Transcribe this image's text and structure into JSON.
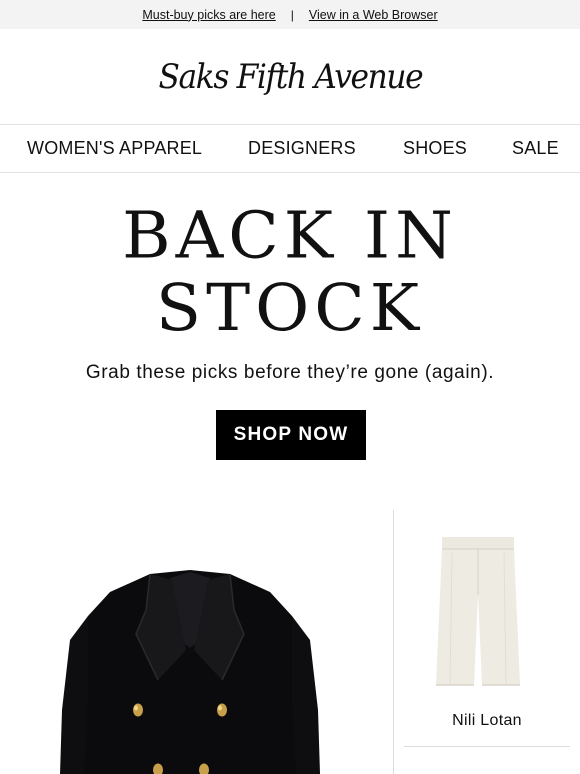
{
  "preheader": {
    "link1": "Must-buy picks are here",
    "separator": "|",
    "link2": "View in a Web Browser"
  },
  "logo": {
    "text": "Saks Fifth Avenue"
  },
  "nav": {
    "items": [
      "WOMEN'S APPAREL",
      "DESIGNERS",
      "SHOES",
      "SALE"
    ]
  },
  "hero": {
    "title_line1": "BACK IN",
    "title_line2": "STOCK",
    "subtitle": "Grab these picks before they’re gone (again).",
    "cta": "SHOP NOW"
  },
  "products": [
    {
      "icon": "black-blazer-image",
      "brand": ""
    },
    {
      "icon": "white-shorts-image",
      "brand": "Nili Lotan"
    }
  ],
  "colors": {
    "preheader_bg": "#f3f3f3",
    "button_bg": "#000000",
    "button_text": "#ffffff",
    "divider": "#dcdcdc"
  }
}
